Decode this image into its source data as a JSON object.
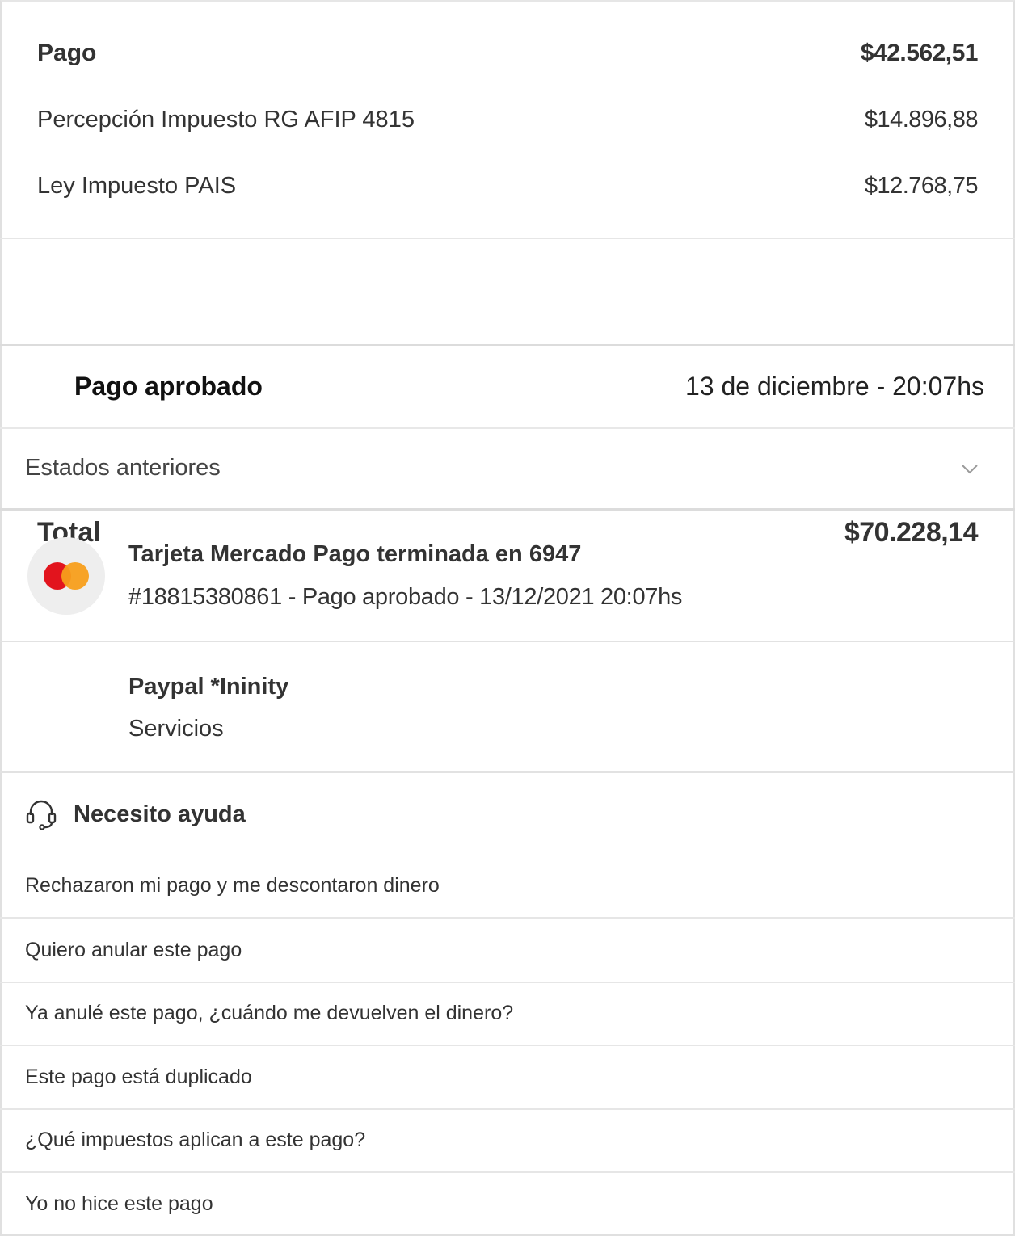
{
  "summary": {
    "pago_label": "Pago",
    "pago_amount": "$42.562,51",
    "percepcion_label": "Percepción Impuesto RG AFIP 4815",
    "percepcion_amount": "$14.896,88",
    "ley_label": "Ley Impuesto PAIS",
    "ley_amount": "$12.768,75"
  },
  "total": {
    "label": "Total",
    "amount": "$70.228,14"
  },
  "status": {
    "title": "Pago aprobado",
    "date": "13 de diciembre - 20:07hs",
    "previous_label": "Estados anteriores",
    "previous_icon": "chevron-down-icon"
  },
  "card": {
    "logo": "mastercard-logo",
    "colors": {
      "red": "#e2141d",
      "orange": "#f79e1b"
    },
    "title": "Tarjeta Mercado Pago terminada en 6947",
    "subtitle": "#18815380861 - Pago aprobado - 13/12/2021 20:07hs"
  },
  "merchant": {
    "name": "Paypal *Ininity",
    "category": "Servicios"
  },
  "help": {
    "icon": "headset-icon",
    "title": "Necesito ayuda",
    "items": [
      "Rechazaron mi pago y me descontaron dinero",
      "Quiero anular este pago",
      "Ya anulé este pago, ¿cuándo me devuelven el dinero?",
      "Este pago está duplicado",
      "¿Qué impuestos aplican a este pago?",
      "Yo no hice este pago"
    ]
  }
}
